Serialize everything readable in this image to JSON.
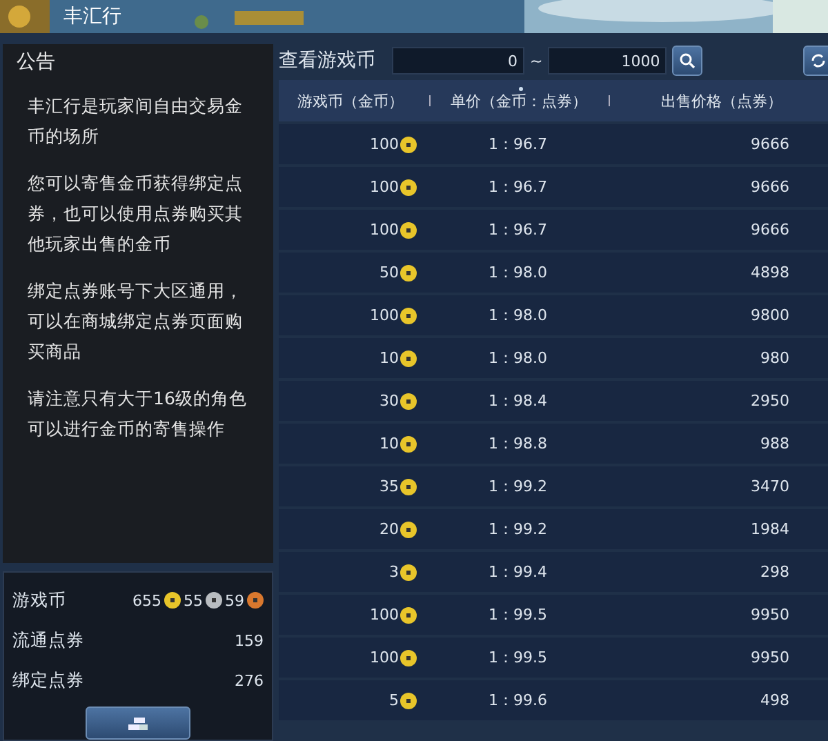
{
  "window": {
    "title": "丰汇行"
  },
  "notice": {
    "title": "公告",
    "paragraphs": [
      "丰汇行是玩家间自由交易金币的场所",
      "您可以寄售金币获得绑定点券，也可以使用点券购买其他玩家出售的金币",
      "绑定点券账号下大区通用，可以在商城绑定点券页面购买商品",
      "请注意只有大于16级的角色可以进行金币的寄售操作"
    ]
  },
  "wallet": {
    "rows": [
      {
        "kind": "coins",
        "label": "游戏币",
        "gold": "655",
        "silver": "55",
        "copper": "59"
      },
      {
        "kind": "plain",
        "label": "流通点券",
        "value": "159"
      },
      {
        "kind": "plain",
        "label": "绑定点券",
        "value": "276"
      }
    ]
  },
  "filter": {
    "label": "查看游戏币",
    "min": "0",
    "separator": "~",
    "max": "1000"
  },
  "table": {
    "columns": [
      {
        "label": "游戏币（金币）",
        "sorted": false
      },
      {
        "label": "单价（金币：点券）",
        "sorted": true
      },
      {
        "label": "出售价格（点券）",
        "sorted": false
      }
    ],
    "rows": [
      {
        "amount": "100",
        "rate": "1：96.7",
        "price": "9666"
      },
      {
        "amount": "100",
        "rate": "1：96.7",
        "price": "9666"
      },
      {
        "amount": "100",
        "rate": "1：96.7",
        "price": "9666"
      },
      {
        "amount": "50",
        "rate": "1：98.0",
        "price": "4898"
      },
      {
        "amount": "100",
        "rate": "1：98.0",
        "price": "9800"
      },
      {
        "amount": "10",
        "rate": "1：98.0",
        "price": "980"
      },
      {
        "amount": "30",
        "rate": "1：98.4",
        "price": "2950"
      },
      {
        "amount": "10",
        "rate": "1：98.8",
        "price": "988"
      },
      {
        "amount": "35",
        "rate": "1：99.2",
        "price": "3470"
      },
      {
        "amount": "20",
        "rate": "1：99.2",
        "price": "1984"
      },
      {
        "amount": "3",
        "rate": "1：99.4",
        "price": "298"
      },
      {
        "amount": "100",
        "rate": "1：99.5",
        "price": "9950"
      },
      {
        "amount": "100",
        "rate": "1：99.5",
        "price": "9950"
      },
      {
        "amount": "5",
        "rate": "1：99.6",
        "price": "498"
      }
    ]
  }
}
